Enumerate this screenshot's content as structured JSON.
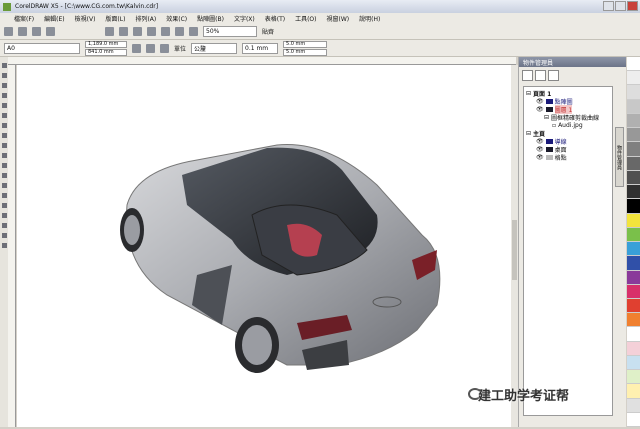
{
  "window": {
    "title": "CorelDRAW X5 - [C:\\www.CG.com.tw\\Kalvin.cdr]"
  },
  "menu": [
    "檔案(F)",
    "編輯(E)",
    "檢視(V)",
    "版面(L)",
    "排列(A)",
    "效果(C)",
    "點陣圖(B)",
    "文字(X)",
    "表格(T)",
    "工具(O)",
    "視窗(W)",
    "說明(H)"
  ],
  "toolbar": {
    "zoom": "50%",
    "snap": "貼齊"
  },
  "propbar": {
    "page_size": "A0",
    "width": "1,189.0 mm",
    "height": "841.0 mm",
    "unit_label": "單位",
    "unit": "公釐",
    "nudge": "0.1 mm",
    "dup_x": "5.0 mm",
    "dup_y": "5.0 mm"
  },
  "docker": {
    "title": "物件管理員",
    "side_tab": "物件管理員",
    "tree": [
      {
        "label": "頁面 1",
        "level": 0,
        "bold": true
      },
      {
        "label": "點陣圖",
        "level": 1,
        "color": "#1a1a7a"
      },
      {
        "label": "圖層 1",
        "level": 1,
        "color": "#c03030"
      },
      {
        "label": "圖框精確剪裁曲線",
        "level": 2
      },
      {
        "label": "Audi.jpg",
        "level": 3
      },
      {
        "label": "主頁",
        "level": 0,
        "bold": true
      },
      {
        "label": "導線",
        "level": 1,
        "color": "#1a1a7a"
      },
      {
        "label": "桌面",
        "level": 1,
        "color": "#1a1a2a"
      },
      {
        "label": "格點",
        "level": 1,
        "color": "#bbbbbb"
      }
    ]
  },
  "watermark": "建工助学考证帮",
  "palette": [
    "#ffffff",
    "#eeeeee",
    "#dddddd",
    "#c8c8c8",
    "#b0b0b0",
    "#989898",
    "#808080",
    "#686868",
    "#505050",
    "#303030",
    "#000000",
    "#f2e43c",
    "#7ac04a",
    "#39a0d8",
    "#3050a8",
    "#8a3a9a",
    "#d8306a",
    "#e04030",
    "#f08030",
    "#ffffff",
    "#f4d0d8",
    "#c8e0f0",
    "#dff0c8",
    "#fff0b0",
    "#e0e0e0",
    "#ffffff"
  ]
}
